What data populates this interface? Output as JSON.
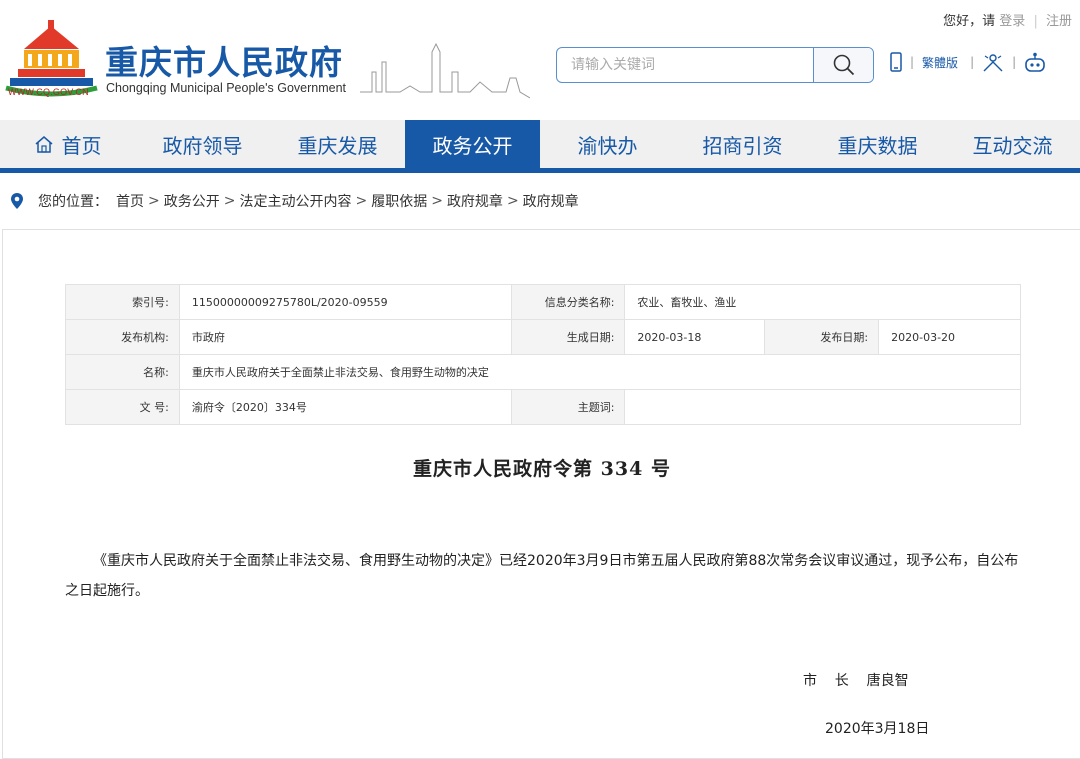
{
  "header": {
    "greeting": "您好，请",
    "login": "登录",
    "register": "注册",
    "site_title": "重庆市人民政府",
    "site_subtitle": "Chongqing Municipal People's Government",
    "site_url": "WWW.CQ.GOV.CN",
    "search_placeholder": "请输入关键词",
    "traditional": "繁體版"
  },
  "nav": {
    "items": [
      {
        "label": "首页"
      },
      {
        "label": "政府领导"
      },
      {
        "label": "重庆发展"
      },
      {
        "label": "政务公开"
      },
      {
        "label": "渝快办"
      },
      {
        "label": "招商引资"
      },
      {
        "label": "重庆数据"
      },
      {
        "label": "互动交流"
      }
    ]
  },
  "breadcrumb": {
    "prefix": "您的位置：",
    "items": [
      "首页",
      "政务公开",
      "法定主动公开内容",
      "履职依据",
      "政府规章",
      "政府规章"
    ]
  },
  "info": {
    "index_label": "索引号:",
    "index_value": "11500000009275780L/2020-09559",
    "category_label": "信息分类名称:",
    "category_value": "农业、畜牧业、渔业",
    "publisher_label": "发布机构:",
    "publisher_value": "市政府",
    "created_label": "生成日期:",
    "created_value": "2020-03-18",
    "published_label": "发布日期:",
    "published_value": "2020-03-20",
    "name_label": "名称:",
    "name_value": "重庆市人民政府关于全面禁止非法交易、食用野生动物的决定",
    "docno_label": "文 号:",
    "docno_value": "渝府令〔2020〕334号",
    "keyword_label": "主题词:",
    "keyword_value": ""
  },
  "document": {
    "title": "重庆市人民政府令第 334 号",
    "body": "《重庆市人民政府关于全面禁止非法交易、食用野生动物的决定》已经2020年3月9日市第五届人民政府第88次常务会议审议通过，现予公布，自公布之日起施行。",
    "signer_title": "市    长",
    "signer_name": "唐良智",
    "date": "2020年3月18日"
  },
  "colors": {
    "brand_blue": "#1859a7",
    "nav_bg": "#f0f0f0"
  }
}
